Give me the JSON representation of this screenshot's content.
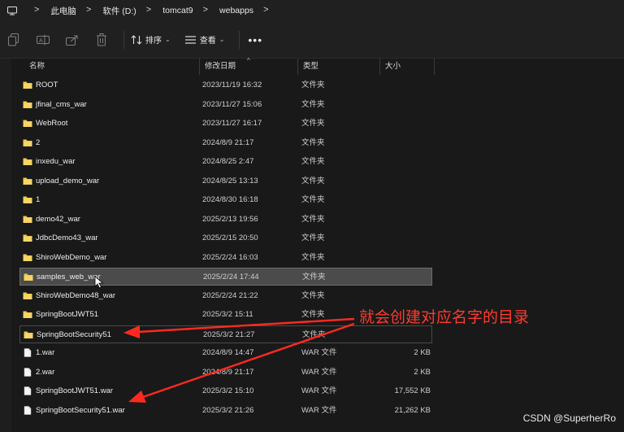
{
  "breadcrumb": {
    "items": [
      "此电脑",
      "软件 (D:)",
      "tomcat9",
      "webapps"
    ]
  },
  "toolbar": {
    "sort_label": "排序",
    "view_label": "查看",
    "more_label": "•••"
  },
  "columns": {
    "name": "名称",
    "date": "修改日期",
    "type": "类型",
    "size": "大小"
  },
  "files": [
    {
      "name": "ROOT",
      "date": "2023/11/19 16:32",
      "type": "文件夹",
      "size": "",
      "kind": "folder"
    },
    {
      "name": "jfinal_cms_war",
      "date": "2023/11/27 15:06",
      "type": "文件夹",
      "size": "",
      "kind": "folder"
    },
    {
      "name": "WebRoot",
      "date": "2023/11/27 16:17",
      "type": "文件夹",
      "size": "",
      "kind": "folder"
    },
    {
      "name": "2",
      "date": "2024/8/9 21:17",
      "type": "文件夹",
      "size": "",
      "kind": "folder"
    },
    {
      "name": "inxedu_war",
      "date": "2024/8/25 2:47",
      "type": "文件夹",
      "size": "",
      "kind": "folder"
    },
    {
      "name": "upload_demo_war",
      "date": "2024/8/25 13:13",
      "type": "文件夹",
      "size": "",
      "kind": "folder"
    },
    {
      "name": "1",
      "date": "2024/8/30 16:18",
      "type": "文件夹",
      "size": "",
      "kind": "folder"
    },
    {
      "name": "demo42_war",
      "date": "2025/2/13 19:56",
      "type": "文件夹",
      "size": "",
      "kind": "folder"
    },
    {
      "name": "JdbcDemo43_war",
      "date": "2025/2/15 20:50",
      "type": "文件夹",
      "size": "",
      "kind": "folder"
    },
    {
      "name": "ShiroWebDemo_war",
      "date": "2025/2/24 16:03",
      "type": "文件夹",
      "size": "",
      "kind": "folder"
    },
    {
      "name": "samples_web_war",
      "date": "2025/2/24 17:44",
      "type": "文件夹",
      "size": "",
      "kind": "folder"
    },
    {
      "name": "ShiroWebDemo48_war",
      "date": "2025/2/24 21:22",
      "type": "文件夹",
      "size": "",
      "kind": "folder"
    },
    {
      "name": "SpringBootJWT51",
      "date": "2025/3/2 15:11",
      "type": "文件夹",
      "size": "",
      "kind": "folder"
    },
    {
      "name": "SpringBootSecurity51",
      "date": "2025/3/2 21:27",
      "type": "文件夹",
      "size": "",
      "kind": "folder"
    },
    {
      "name": "1.war",
      "date": "2024/8/9 14:47",
      "type": "WAR 文件",
      "size": "2 KB",
      "kind": "file"
    },
    {
      "name": "2.war",
      "date": "2024/8/9 21:17",
      "type": "WAR 文件",
      "size": "2 KB",
      "kind": "file"
    },
    {
      "name": "SpringBootJWT51.war",
      "date": "2025/3/2 15:10",
      "type": "WAR 文件",
      "size": "17,552 KB",
      "kind": "file"
    },
    {
      "name": "SpringBootSecurity51.war",
      "date": "2025/3/2 21:26",
      "type": "WAR 文件",
      "size": "21,262 KB",
      "kind": "file"
    }
  ],
  "annotation": {
    "text": "就会创建对应名字的目录",
    "color": "#ff3b30"
  },
  "watermark": "CSDN @SuperherRo",
  "colors": {
    "folder": "#f2c84b",
    "background": "#191919",
    "hover_row": "#4b4b4b"
  }
}
